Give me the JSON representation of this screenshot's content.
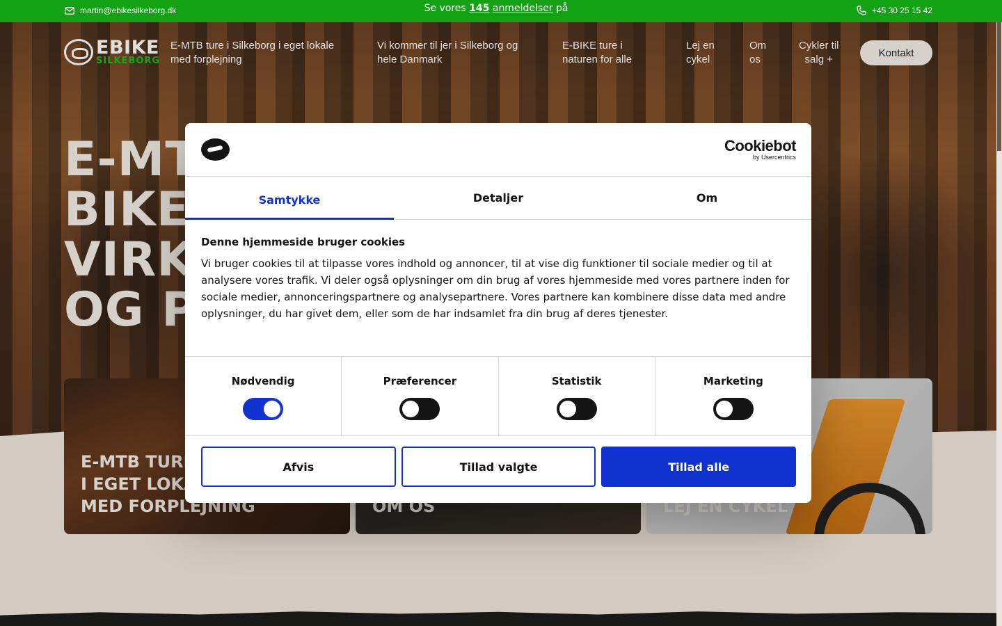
{
  "topbar": {
    "email": "martin@ebikesilkeborg.dk",
    "reviews_prefix": "Se vores",
    "reviews_count": "145",
    "reviews_link": "anmeldelser",
    "reviews_suffix": "på",
    "phone": "+45 30 25 15 42"
  },
  "logo": {
    "line1": "EBIKE",
    "line2": "SILKEBORG"
  },
  "nav": {
    "items": [
      {
        "line1": "E-MTB ture i Silkeborg i eget lokale",
        "line2": "med forplejning"
      },
      {
        "line1": "Vi kommer til jer i Silkeborg og",
        "line2": "hele Danmark"
      },
      {
        "line1": "E-BIKE ture i",
        "line2": "naturen for alle"
      },
      {
        "line1": "Lej en",
        "line2": "cykel"
      },
      {
        "line1": "Om",
        "line2": "os"
      },
      {
        "line1": "Cykler til",
        "line2": "salg +"
      }
    ],
    "contact_button": "Kontakt"
  },
  "hero": {
    "title_lines": [
      "E-MTB",
      "BIKE",
      "VIRK",
      "OG P"
    ]
  },
  "cards": [
    {
      "label_lines": [
        "E-MTB TURE",
        "I EGET LOKALE",
        "MED FORPLEJNING"
      ]
    },
    {
      "label_lines": [
        "OM OS"
      ]
    },
    {
      "label_lines": [
        "LEJ EN CYKEL"
      ]
    }
  ],
  "cookie_dialog": {
    "brand": "Cookiebot",
    "brand_sub": "by Usercentrics",
    "tabs": [
      "Samtykke",
      "Detaljer",
      "Om"
    ],
    "active_tab": "Samtykke",
    "heading": "Denne hjemmeside bruger cookies",
    "body": "Vi bruger cookies til at tilpasse vores indhold og annoncer, til at vise dig funktioner til sociale medier og til at analysere vores trafik. Vi deler også oplysninger om din brug af vores hjemmeside med vores partnere inden for sociale medier, annonceringspartnere og analysepartnere. Vores partnere kan kombinere disse data med andre oplysninger, du har givet dem, eller som de har indsamlet fra din brug af deres tjenester.",
    "consents": [
      {
        "label": "Nødvendig",
        "enabled": true
      },
      {
        "label": "Præferencer",
        "enabled": false
      },
      {
        "label": "Statistik",
        "enabled": false
      },
      {
        "label": "Marketing",
        "enabled": false
      }
    ],
    "buttons": {
      "deny": "Afvis",
      "allow_selected": "Tillad valgte",
      "allow_all": "Tillad alle"
    }
  },
  "colors": {
    "topbar_green": "#13a214",
    "cookie_blue": "#1032cf",
    "cream": "#efe8dc"
  }
}
